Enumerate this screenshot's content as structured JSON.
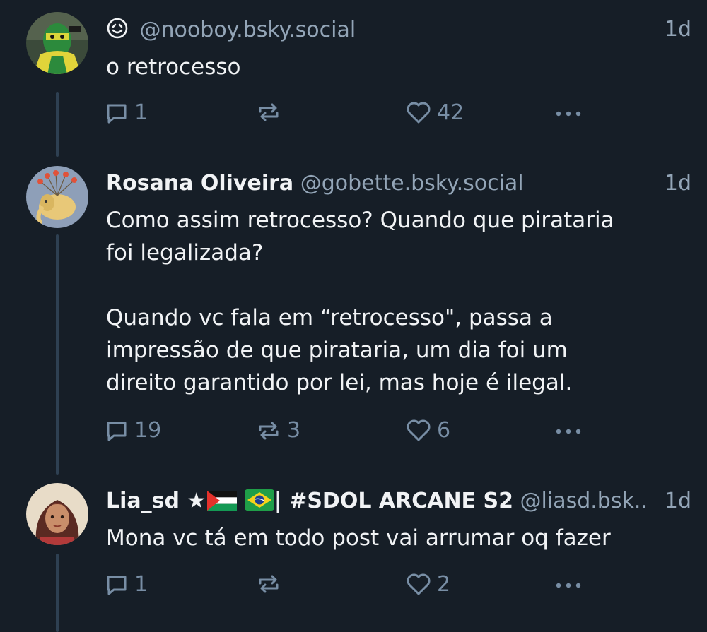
{
  "posts": [
    {
      "display_name": "",
      "handle": "@nooboy.bsky.social",
      "time": "1d",
      "text": "o retrocesso",
      "replies": "1",
      "reposts": "",
      "likes": "42",
      "avatar_icon": "masked-hero-avatar"
    },
    {
      "display_name": "Rosana Oliveira",
      "handle": "@gobette.bsky.social",
      "time": "1d",
      "text": "Como assim retrocesso? Quando que pirataria\nfoi legalizada?\n\nQuando vc fala em “retrocesso\", passa a\nimpressão de que pirataria, um dia foi um\ndireito garantido por lei, mas hoje é ilegal.",
      "replies": "19",
      "reposts": "3",
      "likes": "6",
      "avatar_icon": "mastodon-elephant-avatar"
    },
    {
      "display_name": "Lia_sd ★",
      "display_name_suffix": "| #SDOL ARCANE S2",
      "handle": "@liasd.bsk...",
      "time": "1d",
      "text": "Mona vc tá em todo post vai arrumar oq fazer",
      "replies": "1",
      "reposts": "",
      "likes": "2",
      "avatar_icon": "illustrated-character-avatar"
    }
  ],
  "colors": {
    "background": "#161e27",
    "text": "#f1f3f5",
    "muted": "#93a5b7",
    "icon": "#788ea5",
    "thread_line": "#2e4052"
  }
}
